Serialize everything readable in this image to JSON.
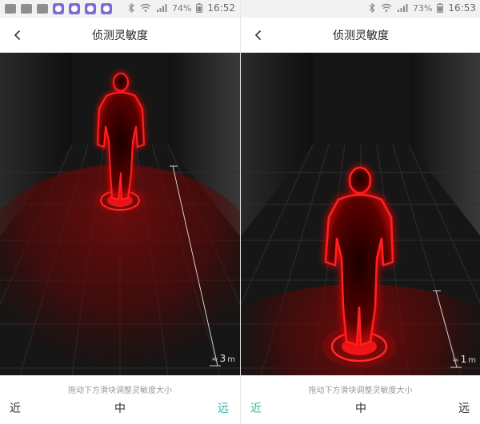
{
  "panels": [
    {
      "status": {
        "battery": "74%",
        "time": "16:52"
      },
      "nav": {
        "title": "侦测灵敏度",
        "back_icon": "chevron-left-icon"
      },
      "scene": {
        "distance_marker": "3",
        "distance_unit": "m",
        "approx_symbol": "≈"
      },
      "hint": "拖动下方滑块调整灵敏度大小",
      "levels": [
        "近",
        "中",
        "远"
      ],
      "selected_level": "远"
    },
    {
      "status": {
        "battery": "73%",
        "time": "16:53"
      },
      "nav": {
        "title": "侦测灵敏度",
        "back_icon": "chevron-left-icon"
      },
      "scene": {
        "distance_marker": "1",
        "distance_unit": "m",
        "approx_symbol": "≈"
      },
      "hint": "拖动下方滑块调整灵敏度大小",
      "levels": [
        "近",
        "中",
        "远"
      ],
      "selected_level": "近"
    }
  ],
  "colors": {
    "accent": "#2fb6a0",
    "figure_red": "#e01010",
    "scene_bg": "#151515"
  }
}
